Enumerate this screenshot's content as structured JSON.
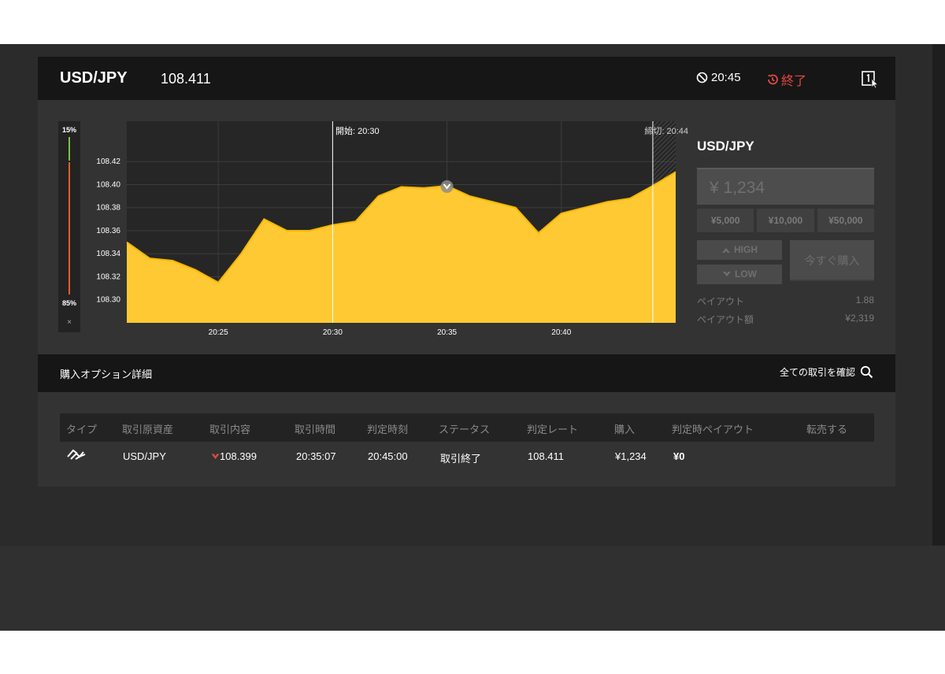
{
  "header": {
    "pair": "USD/JPY",
    "rate": "108.411",
    "time": "20:45",
    "status": "終了",
    "icons": [
      "no-entry-icon",
      "clock-history-icon",
      "expand-window-icon"
    ]
  },
  "gauge": {
    "high_pct": "15%",
    "low_pct": "85%",
    "close": "×",
    "high_fraction": 0.15
  },
  "chart_labels": {
    "start": "開始: 20:30",
    "deadline": "締切: 20:44"
  },
  "chart_data": {
    "type": "area",
    "x": [
      "20:21",
      "20:22",
      "20:23",
      "20:24",
      "20:25",
      "20:26",
      "20:27",
      "20:28",
      "20:29",
      "20:30",
      "20:31",
      "20:32",
      "20:33",
      "20:34",
      "20:35",
      "20:36",
      "20:37",
      "20:38",
      "20:39",
      "20:40",
      "20:41",
      "20:42",
      "20:43",
      "20:44",
      "20:45"
    ],
    "series": [
      {
        "values": [
          108.35,
          108.336,
          108.334,
          108.326,
          108.315,
          108.34,
          108.37,
          108.36,
          108.36,
          108.365,
          108.368,
          108.39,
          108.398,
          108.397,
          108.399,
          108.39,
          108.385,
          108.38,
          108.358,
          108.375,
          108.38,
          108.385,
          108.388,
          108.399,
          108.411
        ]
      }
    ],
    "xticks": [
      "20:25",
      "20:30",
      "20:35",
      "20:40"
    ],
    "yticks": [
      108.3,
      108.32,
      108.34,
      108.36,
      108.38,
      108.4,
      108.42
    ],
    "ylim": [
      108.28,
      108.455
    ],
    "entry_point": {
      "x": "20:35",
      "y": 108.399,
      "direction": "low"
    },
    "color": "#f5b800",
    "grid": true
  },
  "trade": {
    "pair": "USD/JPY",
    "amount": "¥ 1,234",
    "presets": [
      "¥5,000",
      "¥10,000",
      "¥50,000"
    ],
    "high_label": "HIGH",
    "low_label": "LOW",
    "buy_label": "今すぐ購入",
    "payout_label": "ペイアウト",
    "payout_value": "1.88",
    "payout_amount_label": "ペイアウト額",
    "payout_amount_value": "¥2,319"
  },
  "details": {
    "title": "購入オプション詳細",
    "link": "全ての取引を確認",
    "columns": [
      "タイプ",
      "取引原資産",
      "取引内容",
      "取引時間",
      "判定時刻",
      "ステータス",
      "判定レート",
      "購入",
      "判定時ペイアウト",
      "転売する"
    ],
    "rows": [
      {
        "type_icon": "handshake-icon",
        "asset": "USD/JPY",
        "content": "108.399",
        "content_icon": "down-arrow-icon",
        "trade_time": "20:35:07",
        "judge_time": "20:45:00",
        "status": "取引終了",
        "rate": "108.411",
        "purchase": "¥1,234",
        "payout": "¥0",
        "resale": ""
      }
    ]
  },
  "colors": {
    "accent": "#f5b800",
    "negative": "#e5483f",
    "high": "#7bc242",
    "header_bg": "#161616"
  }
}
